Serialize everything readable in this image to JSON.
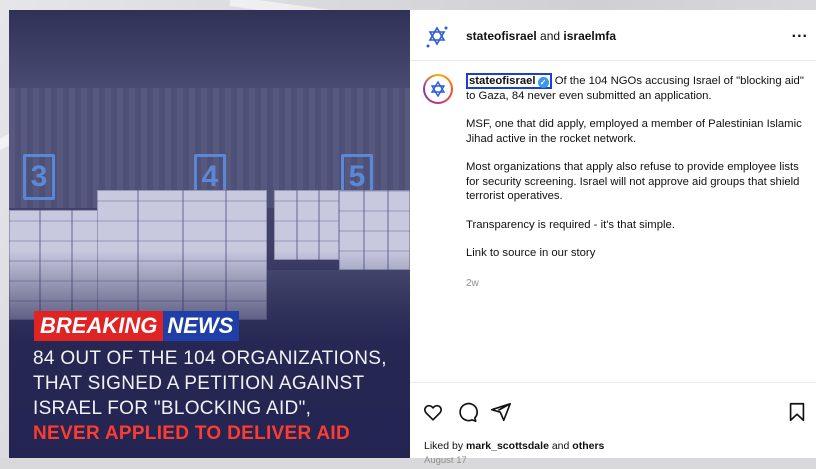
{
  "post_image": {
    "wall_numbers": [
      "3",
      "4",
      "5"
    ],
    "breaking_red": "BREAKING",
    "breaking_blue": "NEWS",
    "headline_lines": [
      "84 OUT OF THE 104 ORGANIZATIONS,",
      "THAT SIGNED A PETITION AGAINST",
      "ISRAEL FOR \"BLOCKING AID\","
    ],
    "headline_alert": "NEVER APPLIED TO DELIVER AID"
  },
  "header": {
    "account_primary": "stateofisrael",
    "joiner": " and ",
    "account_secondary": "israelmfa",
    "more_label": "..."
  },
  "caption": {
    "username": "stateofisrael",
    "verified_mark": "✓",
    "paragraph_1": "Of the 104 NGOs accusing Israel of \"blocking aid\" to Gaza, 84 never even submitted an application.",
    "paragraph_2": "MSF, one that did apply, employed a member of Palestinian Islamic Jihad active in the rocket network.",
    "paragraph_3": "Most organizations that apply also refuse to provide employee lists for security screening. Israel will not approve aid groups that shield terrorist operatives.",
    "paragraph_4": "Transparency is required - it's that simple.",
    "paragraph_5": "Link to source in our story",
    "time_ago": "2w"
  },
  "actions": {
    "icons": [
      "heart-icon",
      "comment-icon",
      "share-icon",
      "bookmark-icon"
    ],
    "liked_prefix": "Liked by ",
    "liked_user": "mark_scottsdale",
    "liked_joiner": " and ",
    "liked_others": "others",
    "date": "August 17"
  },
  "colors": {
    "breaking_red": "#e02424",
    "breaking_blue": "#1f3ea8",
    "alert_text": "#ff3b30",
    "verified_blue": "#3897f0",
    "highlight_box": "#1a3fd6"
  }
}
